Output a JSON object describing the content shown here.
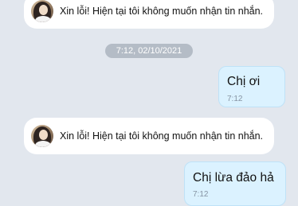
{
  "notices": [
    {
      "text": "Xin lỗi! Hiện tại tôi không muốn nhận tin nhắn."
    },
    {
      "text": "Xin lỗi! Hiện tại tôi không muốn nhận tin nhắn."
    }
  ],
  "date_divider": "7:12, 02/10/2021",
  "messages": [
    {
      "text": "Chị ơi",
      "time": "7:12"
    },
    {
      "text": "Chị lừa đảo hả",
      "time": "7:12"
    }
  ]
}
